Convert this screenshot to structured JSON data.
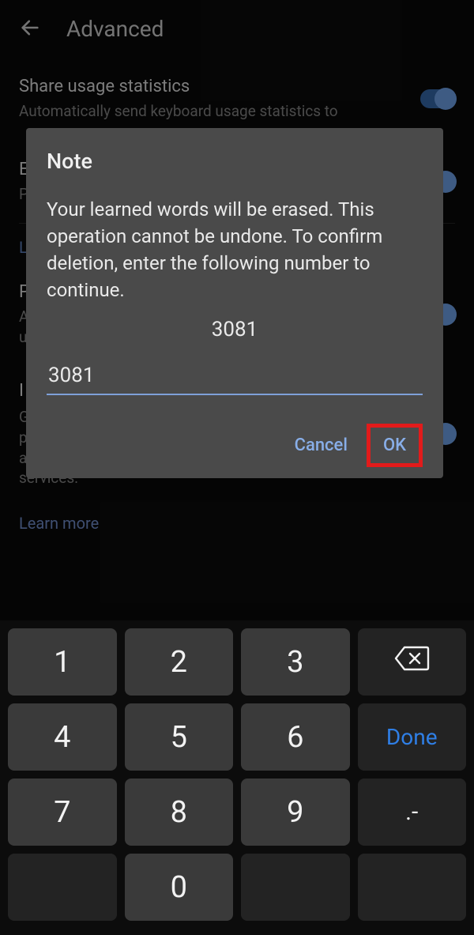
{
  "header": {
    "title": "Advanced"
  },
  "settings": {
    "share": {
      "title": "Share usage statistics",
      "desc": "Automatically send keyboard usage statistics to"
    },
    "emoji": {
      "title": "E",
      "desc": "P"
    },
    "learn": {
      "link": "L"
    },
    "personal": {
      "title": "P",
      "desc1": "A",
      "desc2": "u"
    },
    "improve": {
      "title": "I",
      "desc": "G\nyour device based on your usage patterns. With your permission, Gboard will use these improvements, in the aggregate, to update Google's voice and typing services."
    },
    "learn_more": "Learn more"
  },
  "dialog": {
    "title": "Note",
    "body": "Your learned words will be erased. This operation cannot be undone. To confirm deletion, enter the following number to continue.",
    "number": "3081",
    "input_value": "3081",
    "cancel": "Cancel",
    "ok": "OK"
  },
  "keyboard": {
    "k1": "1",
    "k2": "2",
    "k3": "3",
    "k4": "4",
    "k5": "5",
    "k6": "6",
    "k7": "7",
    "k8": "8",
    "k9": "9",
    "k0": "0",
    "done": "Done",
    "dot": ".-"
  }
}
